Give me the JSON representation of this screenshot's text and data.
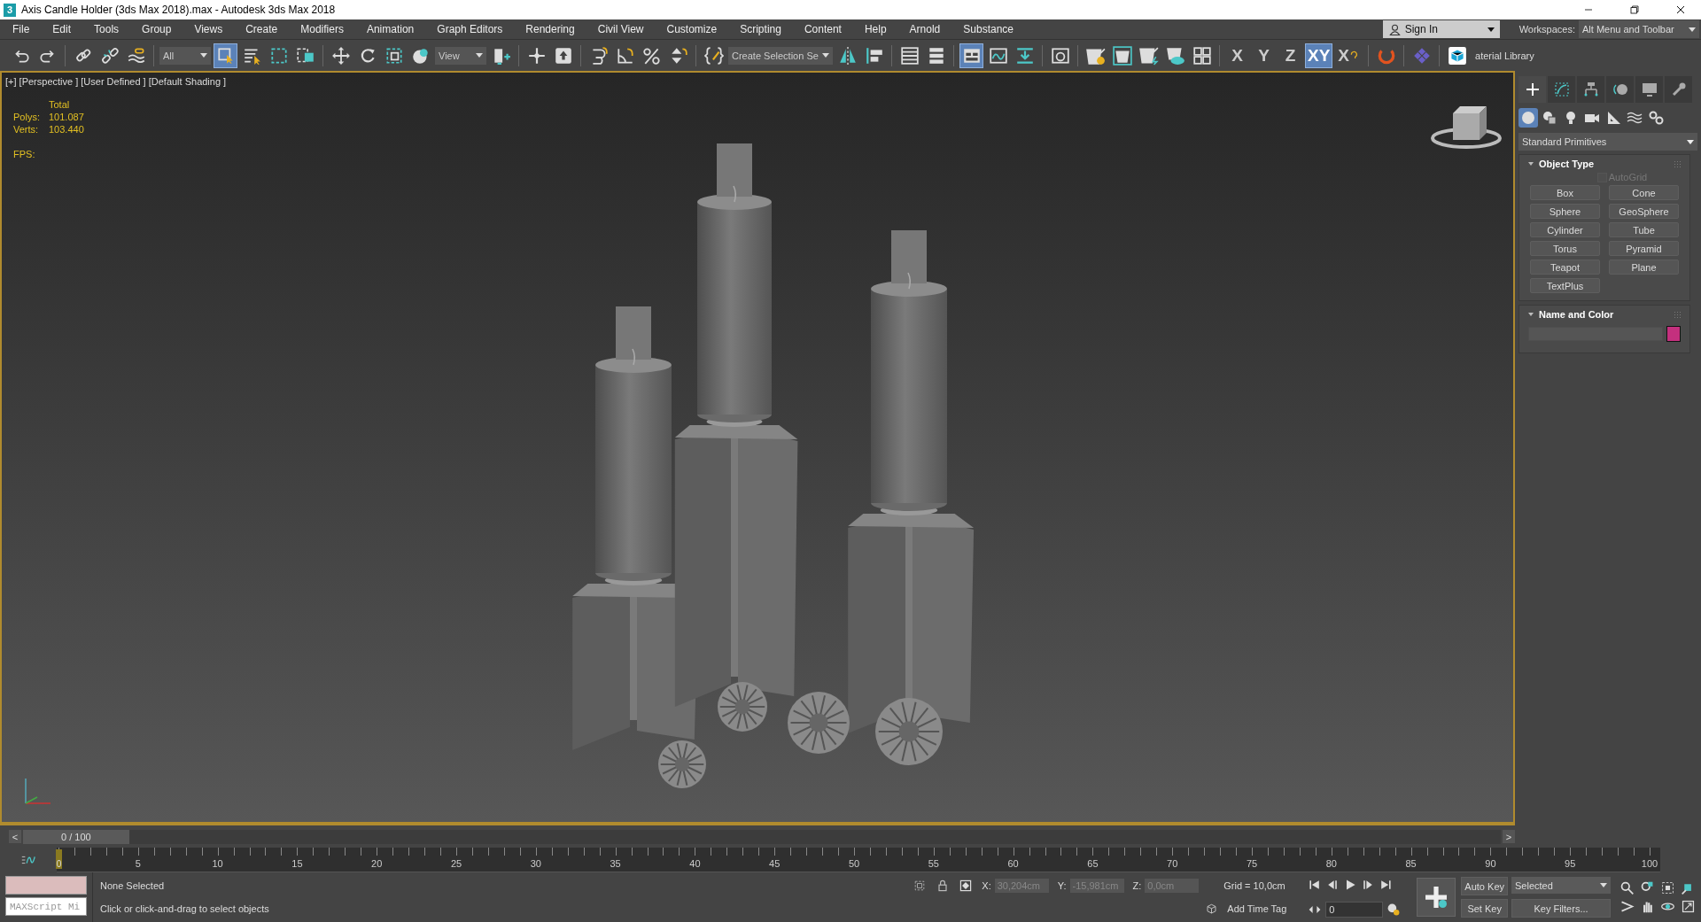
{
  "window": {
    "app_badge": "3",
    "title": "Axis Candle Holder (3ds Max 2018).max - Autodesk 3ds Max 2018"
  },
  "menu": [
    "File",
    "Edit",
    "Tools",
    "Group",
    "Views",
    "Create",
    "Modifiers",
    "Animation",
    "Graph Editors",
    "Rendering",
    "Civil View",
    "Customize",
    "Scripting",
    "Content",
    "Help",
    "Arnold",
    "Substance"
  ],
  "account": {
    "label": "Sign In"
  },
  "workspaces": {
    "label": "Workspaces:",
    "value": "Alt Menu and Toolbar"
  },
  "toolbar": [
    {
      "kind": "undo",
      "selected": false
    },
    {
      "kind": "redo",
      "selected": false
    },
    {
      "kind": "separator"
    },
    {
      "kind": "link",
      "selected": false
    },
    {
      "kind": "unlink",
      "selected": false
    },
    {
      "kind": "bind",
      "selected": false
    },
    {
      "kind": "separator"
    },
    {
      "kind": "dropdown",
      "value": "All"
    },
    {
      "kind": "select",
      "selected": true
    },
    {
      "kind": "select-list",
      "selected": false
    },
    {
      "kind": "region",
      "selected": false
    },
    {
      "kind": "crossing",
      "selected": false
    },
    {
      "kind": "separator"
    },
    {
      "kind": "move",
      "selected": false
    },
    {
      "kind": "rotate",
      "selected": false
    },
    {
      "kind": "scale",
      "selected": false
    },
    {
      "kind": "place",
      "selected": false
    },
    {
      "kind": "dropdown",
      "value": "View"
    },
    {
      "kind": "pivot",
      "selected": false
    },
    {
      "kind": "separator"
    },
    {
      "kind": "manipulate",
      "selected": false
    },
    {
      "kind": "keyboard",
      "selected": false
    },
    {
      "kind": "separator"
    },
    {
      "kind": "snap",
      "selected": false
    },
    {
      "kind": "angle",
      "selected": false
    },
    {
      "kind": "percent",
      "selected": false
    },
    {
      "kind": "spinner",
      "selected": false
    },
    {
      "kind": "separator"
    },
    {
      "kind": "brackets",
      "selected": false
    },
    {
      "kind": "selection-set",
      "value": "Create Selection Se"
    },
    {
      "kind": "mirror",
      "selected": false
    },
    {
      "kind": "align",
      "selected": false
    },
    {
      "kind": "separator"
    },
    {
      "kind": "list",
      "selected": false
    },
    {
      "kind": "layers",
      "selected": false
    },
    {
      "kind": "separator"
    },
    {
      "kind": "ribbon",
      "selected": true
    },
    {
      "kind": "curve",
      "selected": false
    },
    {
      "kind": "download",
      "selected": false
    },
    {
      "kind": "separator"
    },
    {
      "kind": "material",
      "selected": false
    },
    {
      "kind": "separator"
    },
    {
      "kind": "teapot-gear",
      "selected": false
    },
    {
      "kind": "teapot-window",
      "selected": false
    },
    {
      "kind": "teapot-bolt",
      "selected": false
    },
    {
      "kind": "teapot-cloud",
      "selected": false
    },
    {
      "kind": "frames",
      "selected": false
    },
    {
      "kind": "separator"
    },
    {
      "kind": "axis",
      "label": "X",
      "selected": false
    },
    {
      "kind": "axis",
      "label": "Y",
      "selected": false
    },
    {
      "kind": "axis",
      "label": "Z",
      "selected": false
    },
    {
      "kind": "axis",
      "label": "XY",
      "selected": true
    },
    {
      "kind": "axis-cycle",
      "label": "X",
      "selected": false
    },
    {
      "kind": "separator"
    },
    {
      "kind": "ring",
      "selected": false
    },
    {
      "kind": "separator"
    },
    {
      "kind": "diamond",
      "selected": false
    },
    {
      "kind": "separator"
    },
    {
      "kind": "cube",
      "selected": false
    },
    {
      "kind": "label",
      "value": "aterial Library"
    }
  ],
  "viewport": {
    "label": "[+] [Perspective ] [User Defined ] [Default Shading ]",
    "stats": {
      "header": "Total",
      "rows": [
        {
          "label": "Polys:",
          "value": "101.087"
        },
        {
          "label": "Verts:",
          "value": "103.440"
        }
      ],
      "fps": "FPS:"
    }
  },
  "command_panel": {
    "tabs": [
      {
        "kind": "create",
        "selected": true
      },
      {
        "kind": "modify",
        "selected": false
      },
      {
        "kind": "hierarchy",
        "selected": false
      },
      {
        "kind": "motion",
        "selected": false
      },
      {
        "kind": "display",
        "selected": false
      },
      {
        "kind": "utilities",
        "selected": false
      }
    ],
    "categories": [
      {
        "kind": "geometry",
        "selected": true
      },
      {
        "kind": "shapes",
        "selected": false
      },
      {
        "kind": "lights",
        "selected": false
      },
      {
        "kind": "cameras",
        "selected": false
      },
      {
        "kind": "helpers",
        "selected": false
      },
      {
        "kind": "spacewarps",
        "selected": false
      },
      {
        "kind": "systems",
        "selected": false
      }
    ],
    "type_dropdown": "Standard Primitives",
    "object_type": {
      "title": "Object Type",
      "autogrid": {
        "label": "AutoGrid",
        "checked": false,
        "disabled": true
      },
      "buttons": [
        "Box",
        "Cone",
        "Sphere",
        "GeoSphere",
        "Cylinder",
        "Tube",
        "Torus",
        "Pyramid",
        "Teapot",
        "Plane",
        "TextPlus"
      ]
    },
    "name_and_color": {
      "title": "Name and Color",
      "color": "#c4307e"
    }
  },
  "timeline": {
    "prev": "<",
    "frame": "0 / 100",
    "next": ">",
    "thumb": "0",
    "level": 0,
    "ruler": [
      "5",
      "10",
      "15",
      "20",
      "25",
      "30",
      "35",
      "40",
      "45",
      "50",
      "55",
      "60",
      "65",
      "70",
      "75",
      "80",
      "85",
      "90",
      "95",
      "100"
    ]
  },
  "status": {
    "maxscript": "MAXScript Mi",
    "selection": "None Selected",
    "prompt": "Click or click-and-drag to select objects",
    "coords": [
      {
        "axis": "X:",
        "value": "30,204cm"
      },
      {
        "axis": "Y:",
        "value": "-15,981cm"
      },
      {
        "axis": "Z:",
        "value": "0,0cm"
      }
    ],
    "grid": "Grid = 10,0cm",
    "time_tag": "Add Time Tag",
    "frame": "0",
    "auto_key": "Auto Key",
    "key_mode": "Selected",
    "set_key": "Set Key",
    "key_filters": "Key Filters..."
  }
}
